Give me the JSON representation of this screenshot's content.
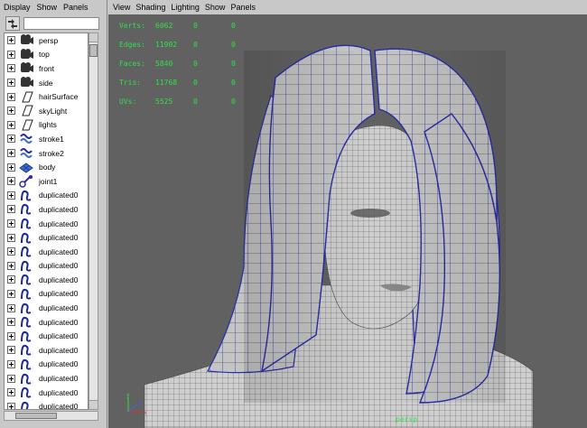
{
  "outliner": {
    "menu": [
      "Display",
      "Show",
      "Panels"
    ],
    "items": [
      {
        "label": "persp",
        "icon": "camera-icon"
      },
      {
        "label": "top",
        "icon": "camera-icon"
      },
      {
        "label": "front",
        "icon": "camera-icon"
      },
      {
        "label": "side",
        "icon": "camera-icon"
      },
      {
        "label": "hairSurface",
        "icon": "plane-icon"
      },
      {
        "label": "skyLight",
        "icon": "plane-icon"
      },
      {
        "label": "lights",
        "icon": "plane-icon"
      },
      {
        "label": "stroke1",
        "icon": "stroke-icon"
      },
      {
        "label": "stroke2",
        "icon": "stroke-icon"
      },
      {
        "label": "body",
        "icon": "mesh-icon"
      },
      {
        "label": "joint1",
        "icon": "joint-icon"
      },
      {
        "label": "duplicated0",
        "icon": "curve-icon"
      },
      {
        "label": "duplicated0",
        "icon": "curve-icon"
      },
      {
        "label": "duplicated0",
        "icon": "curve-icon"
      },
      {
        "label": "duplicated0",
        "icon": "curve-icon"
      },
      {
        "label": "duplicated0",
        "icon": "curve-icon"
      },
      {
        "label": "duplicated0",
        "icon": "curve-icon"
      },
      {
        "label": "duplicated0",
        "icon": "curve-icon"
      },
      {
        "label": "duplicated0",
        "icon": "curve-icon"
      },
      {
        "label": "duplicated0",
        "icon": "curve-icon"
      },
      {
        "label": "duplicated0",
        "icon": "curve-icon"
      },
      {
        "label": "duplicated0",
        "icon": "curve-icon"
      },
      {
        "label": "duplicated0",
        "icon": "curve-icon"
      },
      {
        "label": "duplicated0",
        "icon": "curve-icon"
      },
      {
        "label": "duplicated0",
        "icon": "curve-icon"
      },
      {
        "label": "duplicated0",
        "icon": "curve-icon"
      },
      {
        "label": "duplicated0",
        "icon": "curve-icon"
      }
    ]
  },
  "viewport": {
    "menu": [
      "View",
      "Shading",
      "Lighting",
      "Show",
      "Panels"
    ],
    "hud": [
      {
        "key": "Verts:",
        "value": "6062",
        "a": "0",
        "b": "0"
      },
      {
        "key": "Edges:",
        "value": "11902",
        "a": "0",
        "b": "0"
      },
      {
        "key": "Faces:",
        "value": "5840",
        "a": "0",
        "b": "0"
      },
      {
        "key": "Tris:",
        "value": "11768",
        "a": "0",
        "b": "0"
      },
      {
        "key": "UVs:",
        "value": "5525",
        "a": "0",
        "b": "0"
      }
    ],
    "camera": "persp",
    "axis": {
      "x": "x",
      "y": "y",
      "z": "z"
    },
    "colors": {
      "background": "#616161",
      "hud": "#2ee04a",
      "wire": "#2a2aa8",
      "surface": "#c9c9c9"
    }
  }
}
